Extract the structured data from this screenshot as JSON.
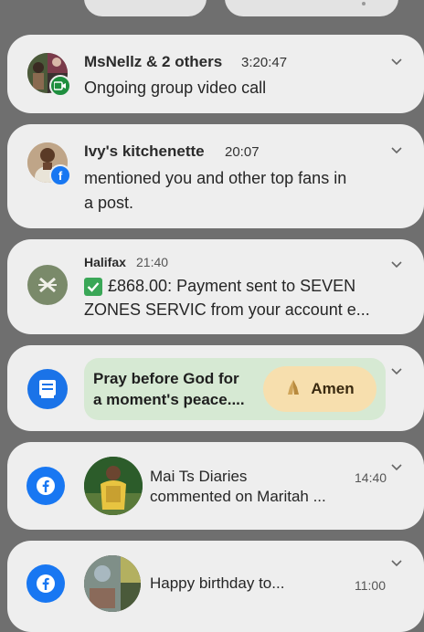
{
  "notifications": [
    {
      "title": "MsNellz & 2 others",
      "time": "3:20:47",
      "body": "Ongoing group video call",
      "badge_icon": "video-call-icon",
      "badge_color": "#1e8e3e"
    },
    {
      "title": "Ivy's kitchenette",
      "time": "20:07",
      "body_line1": "mentioned you and other top fans in",
      "body_line2": "a post.",
      "badge_icon": "facebook-icon",
      "badge_color": "#1877f2"
    },
    {
      "title": "Halifax",
      "time": "21:40",
      "body_line1": "£868.00: Payment sent to SEVEN",
      "body_line2": "ZONES SERVIC from your account e...",
      "check_icon": "check-mark-icon",
      "logo_color": "#7a8a6a"
    },
    {
      "app_icon": "bible-app-icon",
      "message_line1": "Pray before God for",
      "message_line2": "a moment's peace....",
      "action_label": "Amen",
      "action_icon": "praying-hands-icon"
    },
    {
      "title": "Mai Ts Diaries",
      "time": "14:40",
      "body": "commented on Maritah ...",
      "app_icon": "facebook-icon"
    },
    {
      "body": "Happy birthday to...",
      "time": "11:00",
      "app_icon": "facebook-icon"
    }
  ]
}
